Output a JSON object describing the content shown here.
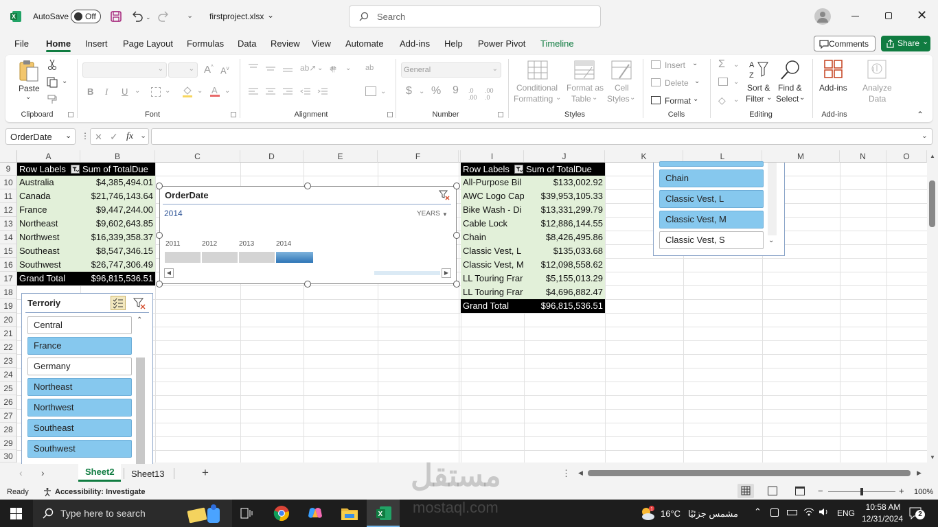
{
  "titlebar": {
    "autosave_label": "AutoSave",
    "autosave_state": "Off",
    "filename": "firstproject.xlsx",
    "search_placeholder": "Search"
  },
  "tabs": [
    "File",
    "Home",
    "Insert",
    "Page Layout",
    "Formulas",
    "Data",
    "Review",
    "View",
    "Automate",
    "Add-ins",
    "Help",
    "Power Pivot",
    "Timeline"
  ],
  "active_tab": "Home",
  "buttons": {
    "comments": "Comments",
    "share": "Share"
  },
  "ribbon": {
    "clipboard": {
      "label": "Clipboard",
      "paste": "Paste"
    },
    "font": {
      "label": "Font"
    },
    "alignment": {
      "label": "Alignment"
    },
    "number": {
      "label": "Number",
      "format": "General"
    },
    "styles": {
      "label": "Styles",
      "conditional1": "Conditional",
      "conditional2": "Formatting",
      "format_as1": "Format as",
      "format_as2": "Table",
      "cell1": "Cell",
      "cell2": "Styles"
    },
    "cells": {
      "label": "Cells",
      "insert": "Insert",
      "delete": "Delete",
      "format": "Format"
    },
    "editing": {
      "label": "Editing",
      "sort1": "Sort &",
      "sort2": "Filter",
      "find1": "Find &",
      "find2": "Select"
    },
    "addins": {
      "label": "Add-ins",
      "addins": "Add-ins",
      "analyze1": "Analyze",
      "analyze2": "Data"
    }
  },
  "formula_bar": {
    "name_box": "OrderDate",
    "fx": "fx"
  },
  "columns": [
    "A",
    "B",
    "C",
    "D",
    "E",
    "F",
    "",
    "I",
    "J",
    "K",
    "L",
    "M",
    "N",
    "O"
  ],
  "rows": [
    "9",
    "10",
    "11",
    "12",
    "13",
    "14",
    "15",
    "16",
    "17",
    "18",
    "19",
    "20",
    "21",
    "22",
    "23",
    "24",
    "25",
    "26",
    "27",
    "28",
    "29",
    "30"
  ],
  "pivot1": {
    "header": [
      "Row Labels",
      "Sum of TotalDue"
    ],
    "rows": [
      [
        "Australia",
        "$4,385,494.01"
      ],
      [
        "Canada",
        "$21,746,143.64"
      ],
      [
        "France",
        "$9,447,244.00"
      ],
      [
        "Northeast",
        "$9,602,643.85"
      ],
      [
        "Northwest",
        "$16,339,358.37"
      ],
      [
        "Southeast",
        "$8,547,346.15"
      ],
      [
        "Southwest",
        "$26,747,306.49"
      ]
    ],
    "total": [
      "Grand Total",
      "$96,815,536.51"
    ]
  },
  "pivot2": {
    "header": [
      "Row Labels",
      "Sum of TotalDue"
    ],
    "rows": [
      [
        "All-Purpose Bil",
        "$133,002.92"
      ],
      [
        "AWC Logo Cap",
        "$39,953,105.33"
      ],
      [
        "Bike Wash - Di",
        "$13,331,299.79"
      ],
      [
        "Cable Lock",
        "$12,886,144.55"
      ],
      [
        "Chain",
        "$8,426,495.86"
      ],
      [
        "Classic Vest, L",
        "$135,033.68"
      ],
      [
        "Classic Vest, M",
        "$12,098,558.62"
      ],
      [
        "LL Touring Frar",
        "$5,155,013.29"
      ],
      [
        "LL Touring Frar",
        "$4,696,882.47"
      ]
    ],
    "total": [
      "Grand Total",
      "$96,815,536.51"
    ]
  },
  "timeline": {
    "title": "OrderDate",
    "selected": "2014",
    "level": "YEARS",
    "years": [
      "2011",
      "2012",
      "2013",
      "2014"
    ],
    "selected_index": 3
  },
  "slicer_territory": {
    "title": "Terroriy",
    "items": [
      {
        "label": "Central",
        "selected": false
      },
      {
        "label": "France",
        "selected": true
      },
      {
        "label": "Germany",
        "selected": false
      },
      {
        "label": "Northeast",
        "selected": true
      },
      {
        "label": "Northwest",
        "selected": true
      },
      {
        "label": "Southeast",
        "selected": true
      },
      {
        "label": "Southwest",
        "selected": true
      }
    ]
  },
  "slicer_product": {
    "items": [
      {
        "label": "Chain",
        "selected": true
      },
      {
        "label": "Classic Vest, L",
        "selected": true
      },
      {
        "label": "Classic Vest, M",
        "selected": true
      },
      {
        "label": "Classic Vest, S",
        "selected": false
      }
    ]
  },
  "sheets": [
    "Sheet2",
    "Sheet13"
  ],
  "active_sheet": "Sheet2",
  "status": {
    "ready": "Ready",
    "accessibility": "Accessibility: Investigate",
    "zoom": "100%"
  },
  "taskbar": {
    "search_placeholder": "Type here to search",
    "temp": "16°C",
    "weather": "مشمس جزئيًا",
    "lang": "ENG",
    "time": "10:58 AM",
    "date": "12/31/2024",
    "notifications": "2"
  },
  "watermark": {
    "arabic": "مستقل",
    "latin": "mostaql.com"
  },
  "colors": {
    "excel_green": "#107c41",
    "slicer_selected": "#86c8ee",
    "pivot_green": "#e2f0d9"
  }
}
